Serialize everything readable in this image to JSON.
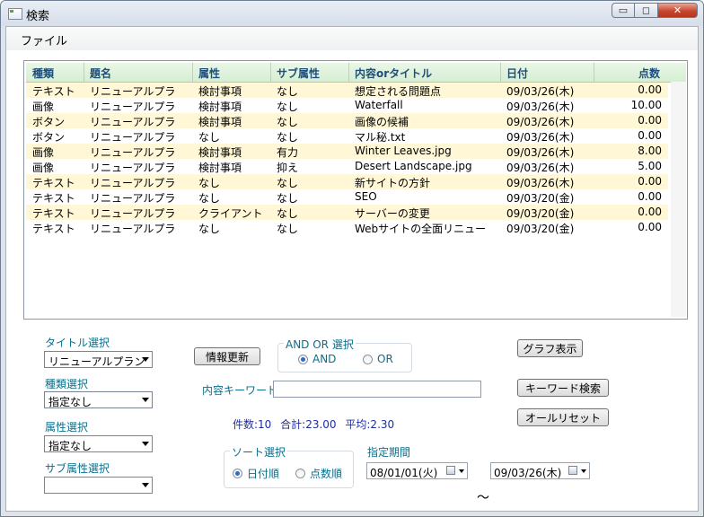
{
  "window": {
    "title": "検索",
    "minimize": "▭",
    "maximize": "◻",
    "close": "✕"
  },
  "menu": {
    "file": "ファイル"
  },
  "table": {
    "headers": [
      "種類",
      "題名",
      "属性",
      "サブ属性",
      "内容orタイトル",
      "日付",
      "点数"
    ],
    "rows": [
      [
        "テキスト",
        "リニューアルプラ",
        "検討事項",
        "なし",
        "想定される問題点",
        "09/03/26(木)",
        "0.00"
      ],
      [
        "画像",
        "リニューアルプラ",
        "検討事項",
        "なし",
        "Waterfall",
        "09/03/26(木)",
        "10.00"
      ],
      [
        "ボタン",
        "リニューアルプラ",
        "検討事項",
        "なし",
        "画像の候補",
        "09/03/26(木)",
        "0.00"
      ],
      [
        "ボタン",
        "リニューアルプラ",
        "なし",
        "なし",
        "マル秘.txt",
        "09/03/26(木)",
        "0.00"
      ],
      [
        "画像",
        "リニューアルプラ",
        "検討事項",
        "有力",
        "Winter Leaves.jpg",
        "09/03/26(木)",
        "8.00"
      ],
      [
        "画像",
        "リニューアルプラ",
        "検討事項",
        "抑え",
        "Desert Landscape.jpg",
        "09/03/26(木)",
        "5.00"
      ],
      [
        "テキスト",
        "リニューアルプラ",
        "なし",
        "なし",
        "新サイトの方針",
        "09/03/26(木)",
        "0.00"
      ],
      [
        "テキスト",
        "リニューアルプラ",
        "なし",
        "なし",
        "SEO",
        "09/03/20(金)",
        "0.00"
      ],
      [
        "テキスト",
        "リニューアルプラ",
        "クライアント",
        "なし",
        "サーバーの変更",
        "09/03/20(金)",
        "0.00"
      ],
      [
        "テキスト",
        "リニューアルプラ",
        "なし",
        "なし",
        "Webサイトの全面リニュー",
        "09/03/20(金)",
        "0.00"
      ]
    ]
  },
  "filters": {
    "title_label": "タイトル選択",
    "title_value": "リニューアルプラン",
    "kind_label": "種類選択",
    "kind_value": "指定なし",
    "attr_label": "属性選択",
    "attr_value": "指定なし",
    "subattr_label": "サブ属性選択",
    "subattr_value": ""
  },
  "controls": {
    "refresh": "情報更新",
    "andor_label": "AND OR 選択",
    "and": "AND",
    "or": "OR",
    "keyword_label": "内容キーワード",
    "keyword_value": "",
    "graph": "グラフ表示",
    "keyword_search": "キーワード検索",
    "reset": "オールリセット",
    "sort_label": "ソート選択",
    "sort_date": "日付順",
    "sort_score": "点数順",
    "period_label": "指定期間",
    "from": "08/01/01(火)",
    "to": "09/03/26(木)",
    "tilde": "～"
  },
  "stats": {
    "count": "件数:10",
    "total": "合計:23.00",
    "avg": "平均:2.30"
  }
}
